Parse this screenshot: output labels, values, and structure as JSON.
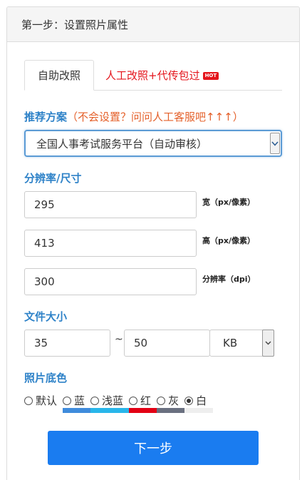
{
  "panel": {
    "title": "第一步：设置照片属性"
  },
  "tabs": {
    "self_service": "自助改照",
    "manual_service": "人工改照+代传包过",
    "hot_badge": "HOT"
  },
  "scheme": {
    "label": "推荐方案",
    "hint": "（不会设置？问问人工客服吧↑↑↑）",
    "selected": "全国人事考试服务平台（自动审核）"
  },
  "resolution": {
    "label": "分辨率/尺寸",
    "width_value": "295",
    "width_unit": "宽（px/像素）",
    "height_value": "413",
    "height_unit": "高（px/像素）",
    "dpi_value": "300",
    "dpi_unit": "分辨率（dpi）"
  },
  "file_size": {
    "label": "文件大小",
    "min": "35",
    "separator": "~",
    "max": "50",
    "unit": "KB"
  },
  "background": {
    "label": "照片底色",
    "options": [
      {
        "label": "默认",
        "color": "",
        "checked": false
      },
      {
        "label": "蓝",
        "color": "#3f8cdc",
        "checked": false
      },
      {
        "label": "浅蓝",
        "color": "#29b6ea",
        "checked": false
      },
      {
        "label": "红",
        "color": "#e30014",
        "checked": false
      },
      {
        "label": "灰",
        "color": "#6a7080",
        "checked": false
      },
      {
        "label": "白",
        "color": "#eeeeee",
        "checked": true
      }
    ]
  },
  "actions": {
    "next": "下一步"
  },
  "colors": {
    "accent": "#1a7cf0",
    "label_blue": "#2e82c8",
    "hint_orange": "#e4602a",
    "red": "#e4151c"
  }
}
